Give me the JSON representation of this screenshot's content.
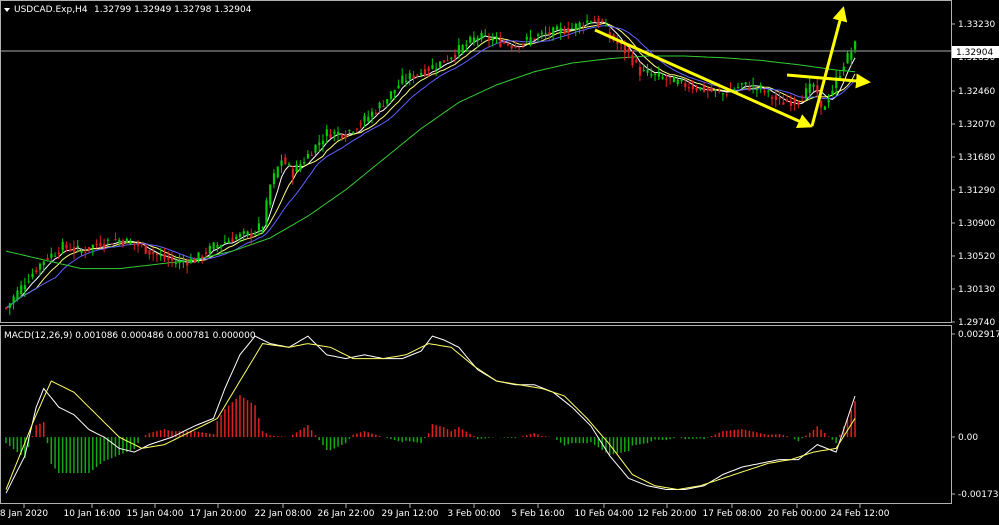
{
  "header": {
    "symbol_title": "USDCAD.Exp,H4",
    "ohlc": "1.32799 1.32949 1.32798 1.32904",
    "menu_icon": "triangle-down-icon"
  },
  "indicator": {
    "title": "MACD(12,26,9) 0.001086 0.000486 0.000781 0.000000"
  },
  "current_price_label": "1.32904",
  "colors": {
    "background": "#000000",
    "grid": "#5a5a5a",
    "bull": "#00cc00",
    "bear": "#e02020",
    "ma_fast": "#ffffff",
    "ma_mid": "#ffff80",
    "ma_slow": "#6060ff",
    "ma_long": "#33cc33",
    "macd_line": "#ffffff",
    "signal_line": "#ffff66",
    "hist_pos": "#e02020",
    "hist_neg": "#11aa11",
    "arrow": "#ffff00",
    "price_line": "#aaaaaa"
  },
  "chart_data": [
    {
      "type": "candlestick",
      "title": "USDCAD.Exp,H4",
      "x_ticks": [
        "8 Jan 2020",
        "10 Jan 16:00",
        "15 Jan 04:00",
        "17 Jan 20:00",
        "22 Jan 08:00",
        "26 Jan 22:00",
        "29 Jan 12:00",
        "3 Feb 00:00",
        "5 Feb 16:00",
        "10 Feb 04:00",
        "12 Feb 20:00",
        "17 Feb 08:00",
        "20 Feb 00:00",
        "24 Feb 12:00"
      ],
      "y_ticks": [
        "1.33230",
        "1.32850",
        "1.32460",
        "1.32070",
        "1.31680",
        "1.31290",
        "1.30900",
        "1.30520",
        "1.30130",
        "1.29740"
      ],
      "ylim": [
        1.2974,
        1.3342
      ],
      "current_price": 1.32904,
      "series": [
        {
          "name": "price",
          "points": [
            [
              0,
              1.299
            ],
            [
              5,
              1.302
            ],
            [
              10,
              1.3045
            ],
            [
              15,
              1.306
            ],
            [
              20,
              1.3055
            ],
            [
              25,
              1.3065
            ],
            [
              30,
              1.3068
            ],
            [
              35,
              1.3062
            ],
            [
              40,
              1.305
            ],
            [
              45,
              1.3042
            ],
            [
              50,
              1.3045
            ],
            [
              55,
              1.306
            ],
            [
              60,
              1.307
            ],
            [
              65,
              1.3075
            ],
            [
              68,
              1.3085
            ],
            [
              70,
              1.313
            ],
            [
              73,
              1.316
            ],
            [
              76,
              1.3145
            ],
            [
              80,
              1.3165
            ],
            [
              85,
              1.319
            ],
            [
              90,
              1.319
            ],
            [
              95,
              1.3205
            ],
            [
              100,
              1.3225
            ],
            [
              105,
              1.325
            ],
            [
              110,
              1.326
            ],
            [
              115,
              1.327
            ],
            [
              120,
              1.3285
            ],
            [
              125,
              1.33
            ],
            [
              130,
              1.3295
            ],
            [
              135,
              1.329
            ],
            [
              140,
              1.33
            ],
            [
              145,
              1.3305
            ],
            [
              150,
              1.331
            ],
            [
              155,
              1.332
            ],
            [
              158,
              1.3315
            ],
            [
              160,
              1.33
            ],
            [
              165,
              1.328
            ],
            [
              168,
              1.326
            ],
            [
              172,
              1.3255
            ],
            [
              176,
              1.325
            ],
            [
              180,
              1.3245
            ],
            [
              185,
              1.324
            ],
            [
              190,
              1.3235
            ],
            [
              195,
              1.3245
            ],
            [
              200,
              1.324
            ],
            [
              205,
              1.3225
            ],
            [
              210,
              1.3228
            ],
            [
              214,
              1.3245
            ],
            [
              216,
              1.3215
            ],
            [
              219,
              1.324
            ],
            [
              222,
              1.327
            ],
            [
              225,
              1.329
            ]
          ]
        },
        {
          "name": "ma_long",
          "points": [
            [
              0,
              1.3055
            ],
            [
              10,
              1.3045
            ],
            [
              20,
              1.3035
            ],
            [
              30,
              1.3035
            ],
            [
              40,
              1.304
            ],
            [
              50,
              1.3045
            ],
            [
              60,
              1.3055
            ],
            [
              70,
              1.307
            ],
            [
              80,
              1.3095
            ],
            [
              90,
              1.3125
            ],
            [
              100,
              1.316
            ],
            [
              110,
              1.3195
            ],
            [
              120,
              1.3225
            ],
            [
              130,
              1.3245
            ],
            [
              140,
              1.326
            ],
            [
              150,
              1.327
            ],
            [
              160,
              1.3275
            ],
            [
              170,
              1.3278
            ],
            [
              180,
              1.3278
            ],
            [
              190,
              1.3276
            ],
            [
              200,
              1.3273
            ],
            [
              210,
              1.3268
            ],
            [
              220,
              1.3262
            ],
            [
              225,
              1.326
            ]
          ]
        }
      ]
    },
    {
      "type": "macd",
      "title": "MACD(12,26,9) 0.001086 0.000486 0.000781 0.000000",
      "y_ticks": [
        "0.002917",
        "0.00",
        "-0.001734"
      ],
      "ylim": [
        -0.001734,
        0.002917
      ],
      "series": [
        {
          "name": "macd",
          "points": [
            [
              0,
              -0.0015
            ],
            [
              5,
              -0.0005
            ],
            [
              8,
              0.0008
            ],
            [
              10,
              0.0013
            ],
            [
              14,
              0.0008
            ],
            [
              18,
              0.0006
            ],
            [
              22,
              0.0002
            ],
            [
              26,
              0.0
            ],
            [
              30,
              -0.0003
            ],
            [
              34,
              -0.0004
            ],
            [
              38,
              -0.0002
            ],
            [
              44,
              0.0
            ],
            [
              50,
              0.0003
            ],
            [
              55,
              0.0005
            ],
            [
              58,
              0.0013
            ],
            [
              62,
              0.0022
            ],
            [
              66,
              0.0027
            ],
            [
              70,
              0.0025
            ],
            [
              75,
              0.0024
            ],
            [
              80,
              0.0027
            ],
            [
              85,
              0.0022
            ],
            [
              90,
              0.0021
            ],
            [
              95,
              0.0022
            ],
            [
              100,
              0.0021
            ],
            [
              105,
              0.0021
            ],
            [
              110,
              0.0023
            ],
            [
              113,
              0.0027
            ],
            [
              116,
              0.0026
            ],
            [
              120,
              0.0024
            ],
            [
              125,
              0.0018
            ],
            [
              130,
              0.0015
            ],
            [
              135,
              0.0014
            ],
            [
              140,
              0.0014
            ],
            [
              145,
              0.0012
            ],
            [
              150,
              0.0008
            ],
            [
              155,
              0.0003
            ],
            [
              160,
              -0.0005
            ],
            [
              165,
              -0.0011
            ],
            [
              170,
              -0.0013
            ],
            [
              175,
              -0.0014
            ],
            [
              180,
              -0.0014
            ],
            [
              185,
              -0.0013
            ],
            [
              190,
              -0.001
            ],
            [
              195,
              -0.0008
            ],
            [
              200,
              -0.0007
            ],
            [
              205,
              -0.0006
            ],
            [
              210,
              -0.0006
            ],
            [
              215,
              -0.0002
            ],
            [
              220,
              -0.0004
            ],
            [
              225,
              0.0011
            ]
          ]
        },
        {
          "name": "signal",
          "points": [
            [
              0,
              -0.0014
            ],
            [
              8,
              0.0006
            ],
            [
              12,
              0.0015
            ],
            [
              18,
              0.0012
            ],
            [
              24,
              0.0006
            ],
            [
              30,
              0.0
            ],
            [
              36,
              -0.0003
            ],
            [
              42,
              -0.0002
            ],
            [
              50,
              0.0002
            ],
            [
              56,
              0.0005
            ],
            [
              62,
              0.0015
            ],
            [
              68,
              0.0025
            ],
            [
              75,
              0.0024
            ],
            [
              80,
              0.0025
            ],
            [
              86,
              0.0024
            ],
            [
              92,
              0.0021
            ],
            [
              100,
              0.0021
            ],
            [
              106,
              0.0022
            ],
            [
              112,
              0.0025
            ],
            [
              118,
              0.0024
            ],
            [
              124,
              0.0019
            ],
            [
              130,
              0.0015
            ],
            [
              136,
              0.0014
            ],
            [
              142,
              0.0013
            ],
            [
              148,
              0.0011
            ],
            [
              154,
              0.0005
            ],
            [
              160,
              -0.0002
            ],
            [
              166,
              -0.001
            ],
            [
              172,
              -0.0013
            ],
            [
              178,
              -0.0014
            ],
            [
              184,
              -0.0013
            ],
            [
              190,
              -0.0011
            ],
            [
              196,
              -0.0009
            ],
            [
              202,
              -0.0007
            ],
            [
              208,
              -0.0006
            ],
            [
              214,
              -0.0004
            ],
            [
              220,
              -0.0003
            ],
            [
              225,
              0.0005
            ]
          ]
        }
      ]
    }
  ]
}
